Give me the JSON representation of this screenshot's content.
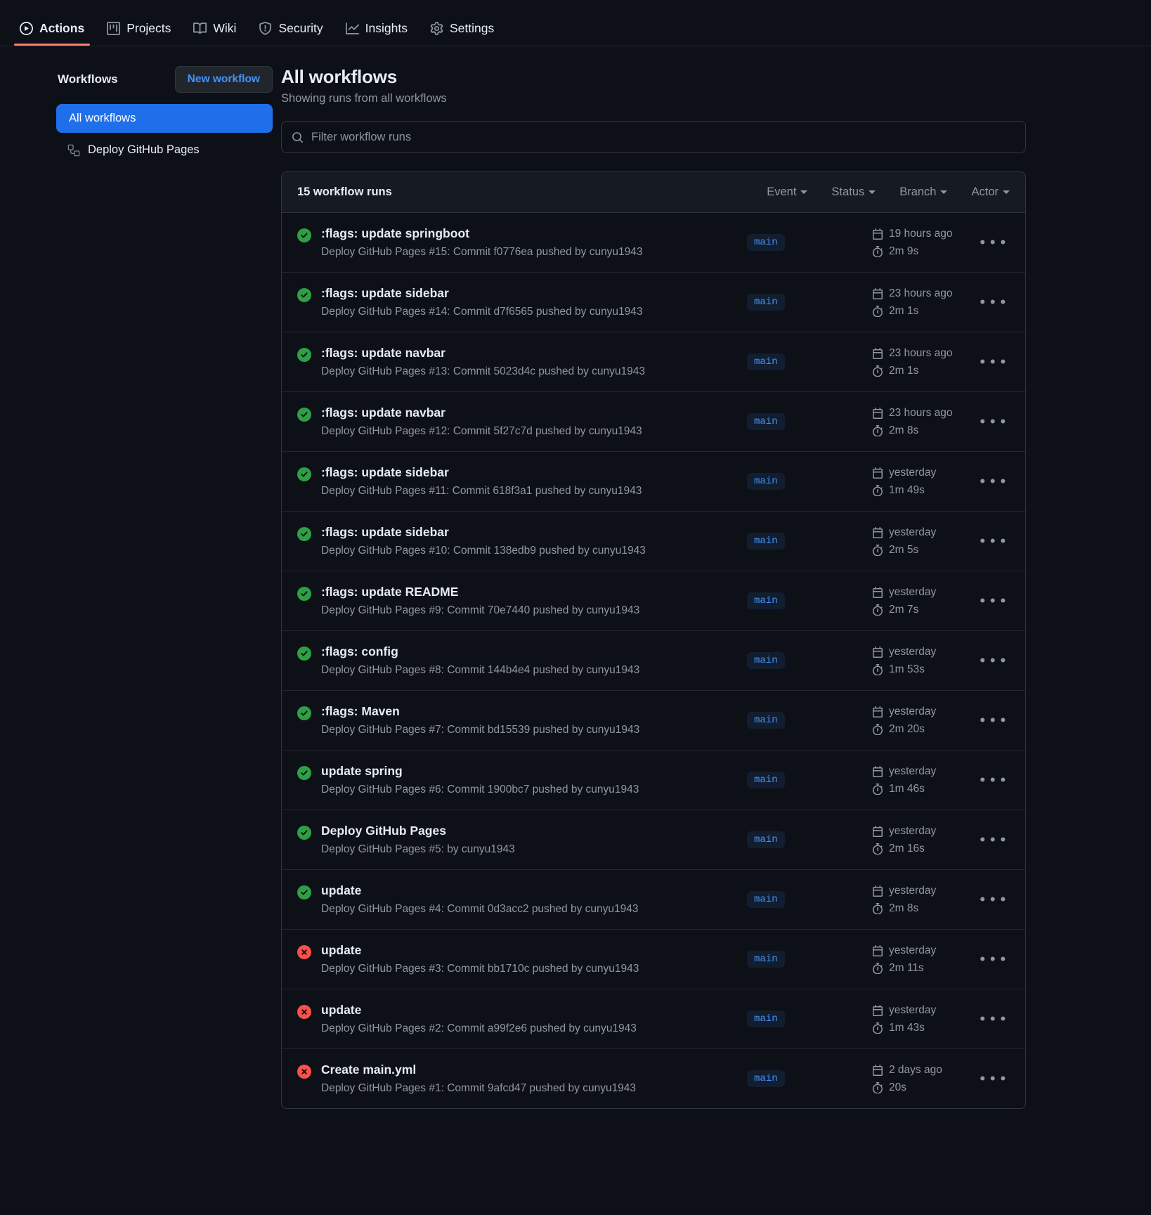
{
  "nav": {
    "items": [
      {
        "label": "Actions",
        "icon": "play-circle-icon",
        "active": true
      },
      {
        "label": "Projects",
        "icon": "project-board-icon",
        "active": false
      },
      {
        "label": "Wiki",
        "icon": "book-icon",
        "active": false
      },
      {
        "label": "Security",
        "icon": "shield-icon",
        "active": false
      },
      {
        "label": "Insights",
        "icon": "graph-icon",
        "active": false
      },
      {
        "label": "Settings",
        "icon": "gear-icon",
        "active": false
      }
    ]
  },
  "sidebar": {
    "title": "Workflows",
    "new_workflow_label": "New workflow",
    "items": [
      {
        "label": "All workflows",
        "active": true,
        "icon": null
      },
      {
        "label": "Deploy GitHub Pages",
        "active": false,
        "icon": "workflow-icon"
      }
    ]
  },
  "main": {
    "title": "All workflows",
    "subtitle": "Showing runs from all workflows",
    "search": {
      "value": "",
      "placeholder": "Filter workflow runs",
      "icon": "search-icon"
    },
    "runs_count_label": "15 workflow runs",
    "filters": [
      {
        "label": "Event"
      },
      {
        "label": "Status"
      },
      {
        "label": "Branch"
      },
      {
        "label": "Actor"
      }
    ],
    "colors": {
      "success": "#2ea043",
      "failure": "#f85149",
      "accent": "#4493f8",
      "active_sidebar": "#1f6feb",
      "tab_underline": "#f78166"
    },
    "runs": [
      {
        "status": "success",
        "title": ":flags: update springboot",
        "subtitle": "Deploy GitHub Pages #15: Commit f0776ea pushed by cunyu1943",
        "branch": "main",
        "time": "19 hours ago",
        "duration": "2m 9s"
      },
      {
        "status": "success",
        "title": ":flags: update sidebar",
        "subtitle": "Deploy GitHub Pages #14: Commit d7f6565 pushed by cunyu1943",
        "branch": "main",
        "time": "23 hours ago",
        "duration": "2m 1s"
      },
      {
        "status": "success",
        "title": ":flags: update navbar",
        "subtitle": "Deploy GitHub Pages #13: Commit 5023d4c pushed by cunyu1943",
        "branch": "main",
        "time": "23 hours ago",
        "duration": "2m 1s"
      },
      {
        "status": "success",
        "title": ":flags: update navbar",
        "subtitle": "Deploy GitHub Pages #12: Commit 5f27c7d pushed by cunyu1943",
        "branch": "main",
        "time": "23 hours ago",
        "duration": "2m 8s"
      },
      {
        "status": "success",
        "title": ":flags: update sidebar",
        "subtitle": "Deploy GitHub Pages #11: Commit 618f3a1 pushed by cunyu1943",
        "branch": "main",
        "time": "yesterday",
        "duration": "1m 49s"
      },
      {
        "status": "success",
        "title": ":flags: update sidebar",
        "subtitle": "Deploy GitHub Pages #10: Commit 138edb9 pushed by cunyu1943",
        "branch": "main",
        "time": "yesterday",
        "duration": "2m 5s"
      },
      {
        "status": "success",
        "title": ":flags: update README",
        "subtitle": "Deploy GitHub Pages #9: Commit 70e7440 pushed by cunyu1943",
        "branch": "main",
        "time": "yesterday",
        "duration": "2m 7s"
      },
      {
        "status": "success",
        "title": ":flags: config",
        "subtitle": "Deploy GitHub Pages #8: Commit 144b4e4 pushed by cunyu1943",
        "branch": "main",
        "time": "yesterday",
        "duration": "1m 53s"
      },
      {
        "status": "success",
        "title": ":flags: Maven",
        "subtitle": "Deploy GitHub Pages #7: Commit bd15539 pushed by cunyu1943",
        "branch": "main",
        "time": "yesterday",
        "duration": "2m 20s"
      },
      {
        "status": "success",
        "title": "update spring",
        "subtitle": "Deploy GitHub Pages #6: Commit 1900bc7 pushed by cunyu1943",
        "branch": "main",
        "time": "yesterday",
        "duration": "1m 46s"
      },
      {
        "status": "success",
        "title": "Deploy GitHub Pages",
        "subtitle": "Deploy GitHub Pages #5: by cunyu1943",
        "branch": "main",
        "time": "yesterday",
        "duration": "2m 16s"
      },
      {
        "status": "success",
        "title": "update",
        "subtitle": "Deploy GitHub Pages #4: Commit 0d3acc2 pushed by cunyu1943",
        "branch": "main",
        "time": "yesterday",
        "duration": "2m 8s"
      },
      {
        "status": "failure",
        "title": "update",
        "subtitle": "Deploy GitHub Pages #3: Commit bb1710c pushed by cunyu1943",
        "branch": "main",
        "time": "yesterday",
        "duration": "2m 11s"
      },
      {
        "status": "failure",
        "title": "update",
        "subtitle": "Deploy GitHub Pages #2: Commit a99f2e6 pushed by cunyu1943",
        "branch": "main",
        "time": "yesterday",
        "duration": "1m 43s"
      },
      {
        "status": "failure",
        "title": "Create main.yml",
        "subtitle": "Deploy GitHub Pages #1: Commit 9afcd47 pushed by cunyu1943",
        "branch": "main",
        "time": "2 days ago",
        "duration": "20s"
      }
    ],
    "row_icons": {
      "calendar": "calendar-icon",
      "stopwatch": "stopwatch-icon",
      "kebab": "overflow-menu-icon",
      "kebab_glyph": "• • •"
    }
  }
}
